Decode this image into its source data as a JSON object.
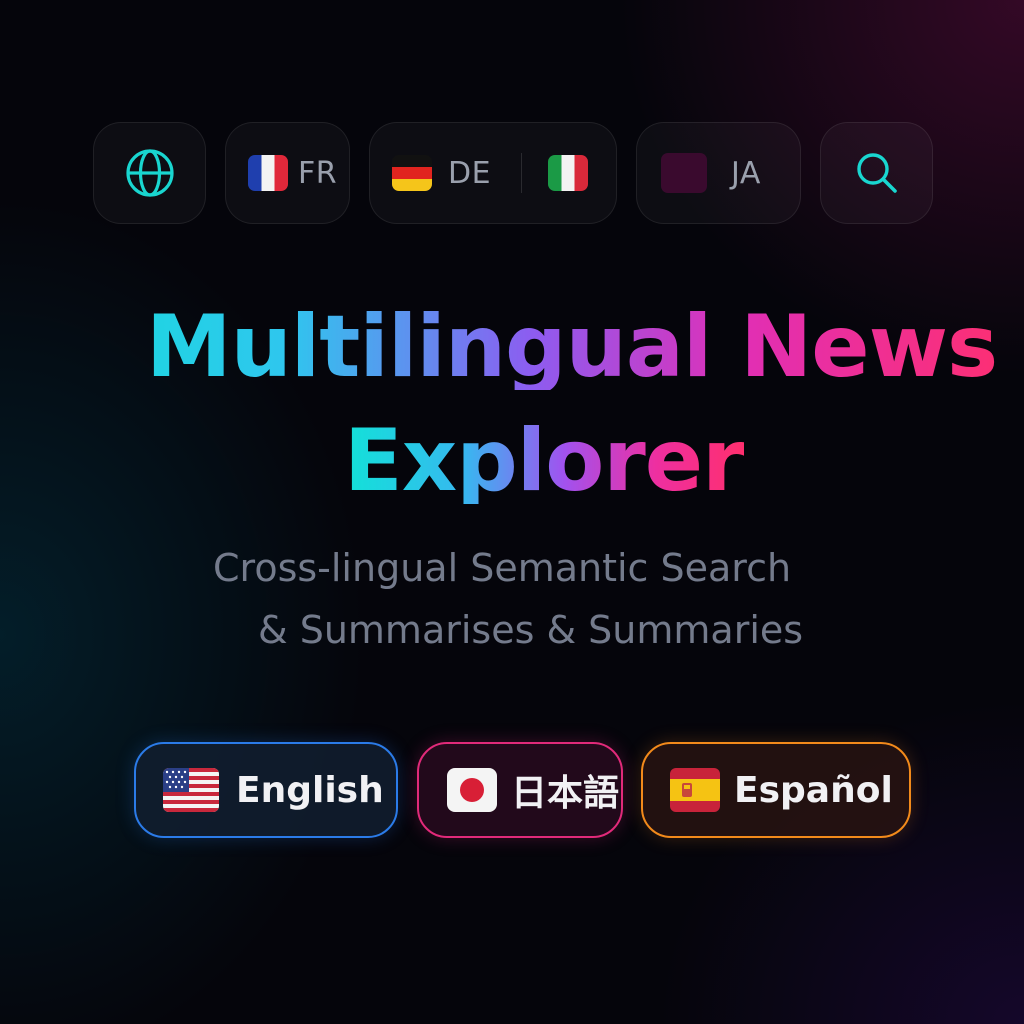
{
  "toolbar": {
    "chips": [
      {
        "code": "FR"
      },
      {
        "code": "DE"
      },
      {
        "code": "JA"
      }
    ]
  },
  "hero": {
    "title_line1": "Multilingual News",
    "title_line2": "Explorer",
    "subtitle_line1": "Cross-lingual Semantic Search",
    "subtitle_line2": "& Summarises & Summaries"
  },
  "languages": [
    {
      "label": "English"
    },
    {
      "label": "日本語"
    },
    {
      "label": "Español"
    }
  ],
  "colors": {
    "teal": "#12e2d8",
    "pink": "#e02fb6",
    "english_border": "#2b7be8",
    "japanese_border": "#e12a7a",
    "spanish_border": "#f28a1b"
  },
  "icons": [
    "globe-icon",
    "search-icon",
    "flag-fr-icon",
    "flag-de-icon",
    "flag-it-icon",
    "flag-ja-icon",
    "flag-us-icon",
    "flag-es-icon"
  ]
}
